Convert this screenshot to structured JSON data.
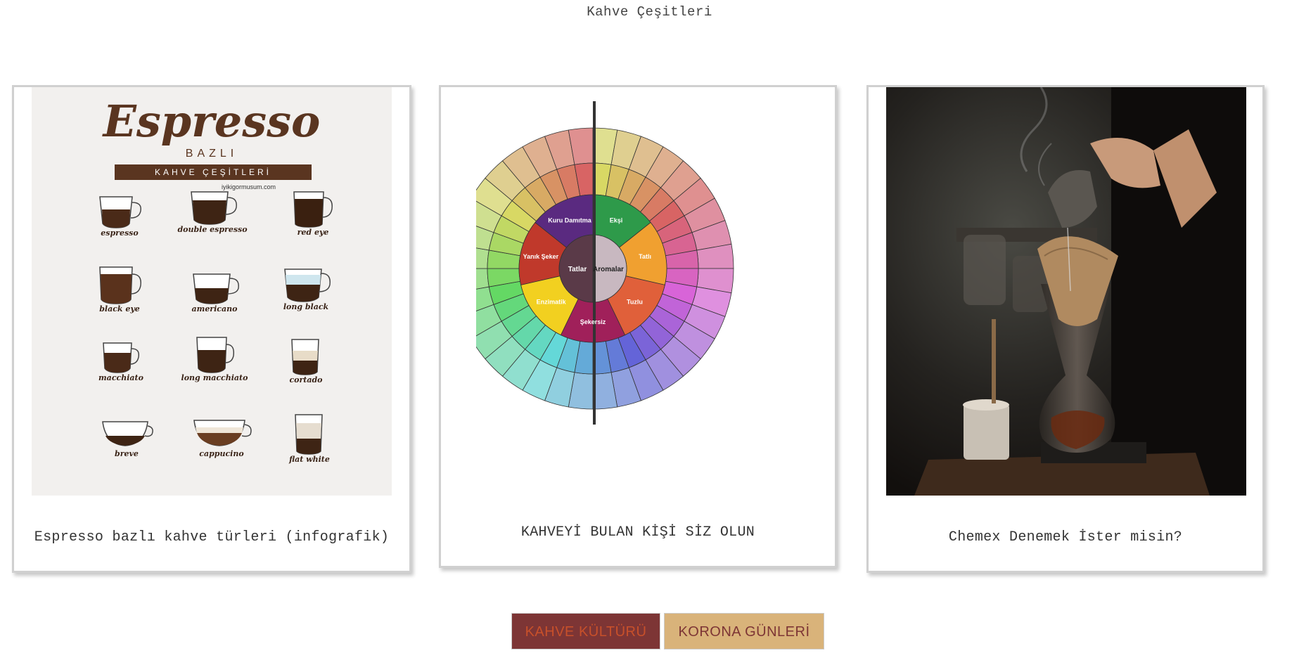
{
  "page": {
    "title": "Kahve Çeşitleri"
  },
  "cards": [
    {
      "caption": "Espresso bazlı kahve türleri (infografik)",
      "infographic": {
        "title": "Espresso",
        "subtitle": "BAZLI",
        "band": "KAHVE ÇEŞİTLERİ",
        "site": "iyikigormusum.com",
        "drinks": [
          "espresso",
          "double espresso",
          "red eye",
          "black eye",
          "americano",
          "long black",
          "macchiato",
          "long macchiato",
          "cortado",
          "breve",
          "cappucino",
          "flat white"
        ]
      }
    },
    {
      "caption": "KAHVEYİ BULAN KİŞİ SİZ OLUN",
      "wheel": {
        "center_left": "Tatlar",
        "center_right": "Aromalar",
        "inner": [
          "Ekşi",
          "Tatlı",
          "Tuzlu",
          "Şekersiz",
          "Enzimatik",
          "Yanık Şeker",
          "Kuru Damıtma"
        ],
        "colors": [
          "#2e9a4a",
          "#f0a030",
          "#e0603a",
          "#a0205a",
          "#f2d020",
          "#c0392b",
          "#5a2a80"
        ]
      }
    },
    {
      "caption": "Chemex Denemek İster misin?"
    }
  ],
  "buttons": {
    "kahve_kulturu": "KAHVE KÜLTÜRÜ",
    "korona_gunleri": "KORONA GÜNLERİ"
  }
}
